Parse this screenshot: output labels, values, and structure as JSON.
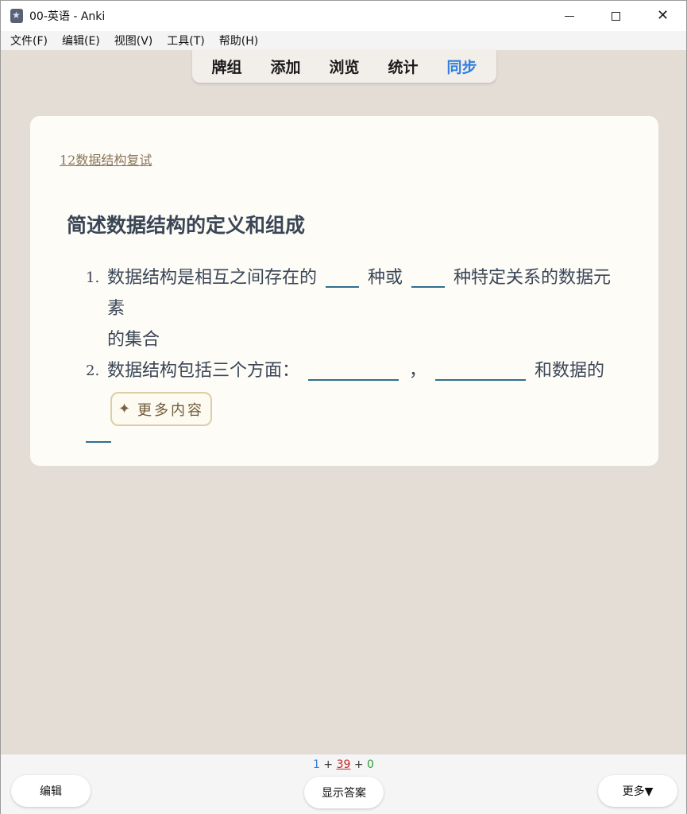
{
  "window": {
    "title": "00-英语 - Anki"
  },
  "menu": {
    "items": [
      "文件(F)",
      "编辑(E)",
      "视图(V)",
      "工具(T)",
      "帮助(H)"
    ]
  },
  "toolbar": {
    "items": [
      {
        "label": "牌组",
        "active": false
      },
      {
        "label": "添加",
        "active": false
      },
      {
        "label": "浏览",
        "active": false
      },
      {
        "label": "统计",
        "active": false
      },
      {
        "label": "同步",
        "active": true
      }
    ],
    "active_color": "#2f7fe0"
  },
  "card": {
    "deck_link": "12数据结构复试",
    "question": "简述数据结构的定义和组成",
    "answers": [
      {
        "number": "1.",
        "line1_a": "数据结构是相互之间存在的",
        "line1_b": "种或",
        "line1_c": "种特定关系的数据元素",
        "line2": "的集合"
      },
      {
        "number": "2.",
        "line1_a": "数据结构包括三个方面：",
        "line1_b": "，",
        "line1_c": "和数据的"
      }
    ],
    "more_button": "更多内容"
  },
  "bottom": {
    "counts": {
      "new": "1",
      "learn": "39",
      "review": "0",
      "plus": "+"
    },
    "edit_button": "编辑",
    "show_answer_button": "显示答案",
    "more_button": "更多▼"
  }
}
